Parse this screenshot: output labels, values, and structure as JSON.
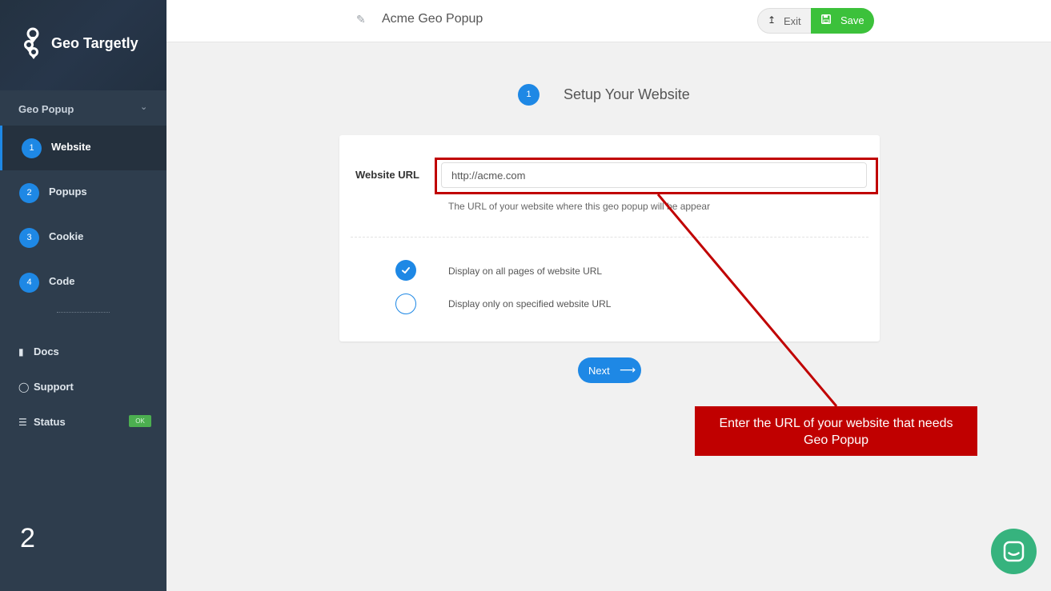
{
  "sidebar": {
    "brand": "Geo Targetly",
    "section": "Geo Popup",
    "steps": [
      {
        "num": "1",
        "label": "Website"
      },
      {
        "num": "2",
        "label": "Popups"
      },
      {
        "num": "3",
        "label": "Cookie"
      },
      {
        "num": "4",
        "label": "Code"
      }
    ],
    "links": [
      {
        "label": "Docs",
        "icon": "book-icon"
      },
      {
        "label": "Support",
        "icon": "chat-icon"
      },
      {
        "label": "Status",
        "icon": "database-icon"
      }
    ],
    "status_badge": "OK",
    "page_number": "2"
  },
  "topbar": {
    "title": "Acme Geo Popup",
    "exit_label": "Exit",
    "save_label": "Save"
  },
  "step": {
    "num": "1",
    "title": "Setup Your Website"
  },
  "form": {
    "url_label": "Website URL",
    "url_value": "http://acme.com",
    "url_help": "The URL of your website where this geo popup will be appear",
    "options": [
      {
        "label": "Display on all pages of website URL",
        "checked": true
      },
      {
        "label": "Display only on specified website URL",
        "checked": false
      }
    ],
    "next_label": "Next"
  },
  "annotation": {
    "callout_line1": "Enter the URL of your website that needs",
    "callout_line2": "Geo Popup",
    "color": "#c00000"
  },
  "colors": {
    "accent": "#1e88e5",
    "save": "#3cc13b",
    "sidebar": "#2e3d4d"
  }
}
